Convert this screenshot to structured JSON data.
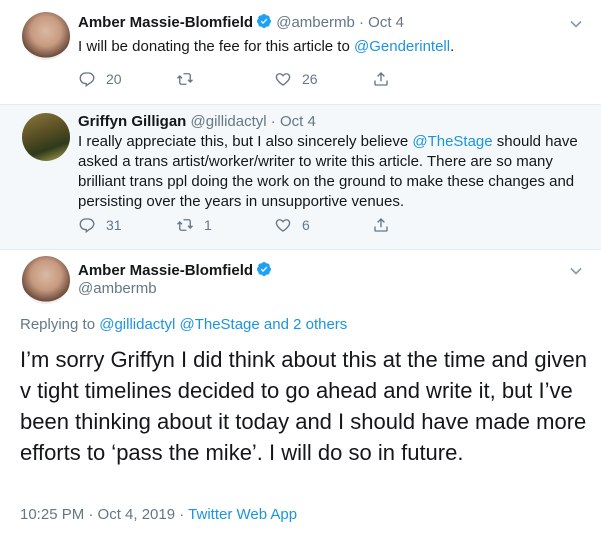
{
  "tweets": [
    {
      "author_name": "Amber Massie-Blomfield",
      "handle": "@ambermb",
      "separator": "·",
      "date": "Oct 4",
      "text_before": "I will be donating the fee for this article to ",
      "text_link": "@Genderintell",
      "text_after": ".",
      "reply_count": "20",
      "retweet_count": "",
      "like_count": "26"
    },
    {
      "author_name": "Griffyn Gilligan",
      "handle": "@gillidactyl",
      "separator": "·",
      "date": "Oct 4",
      "text_before": "I really appreciate this, but I also sincerely believe ",
      "text_link": "@TheStage",
      "text_after": " should have asked a trans artist/worker/writer to write this article. There are so many brilliant trans ppl doing the work on the ground to make these changes and persisting over the years in unsupportive venues.",
      "reply_count": "31",
      "retweet_count": "1",
      "like_count": "6"
    }
  ],
  "main_tweet": {
    "author_name": "Amber Massie-Blomfield",
    "handle": "@ambermb",
    "replying_prefix": "Replying to ",
    "replying_to": "@gillidactyl @TheStage and 2 others",
    "text": "I’m sorry Griffyn I did think about this at the time and given v tight timelines decided to go ahead and write it, but I’ve been thinking about it today and I should have made more efforts to ‘pass the mike’. I will do so in future.",
    "timestamp": "10:25 PM · Oct 4, 2019 · ",
    "source": "Twitter Web App"
  },
  "colors": {
    "link": "#1b95e0",
    "muted": "#657786",
    "verified": "#1da1f2",
    "highlight_bg": "#f5f8fa"
  },
  "icons": [
    "verified-badge-icon",
    "chevron-down-icon",
    "reply-icon",
    "retweet-icon",
    "like-icon",
    "share-icon"
  ]
}
